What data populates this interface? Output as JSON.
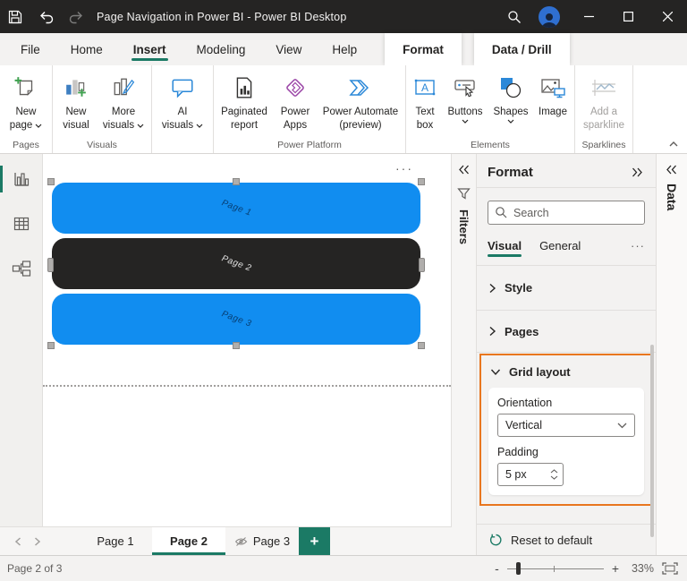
{
  "colors": {
    "accent_green": "#1B7A65",
    "button_blue": "#118DF0",
    "button_black": "#252423",
    "highlight_orange": "#E8761E",
    "titlebar_bg": "#252423"
  },
  "titlebar": {
    "title": "Page Navigation in Power BI - Power BI Desktop"
  },
  "menu": {
    "tabs": [
      {
        "label": "File"
      },
      {
        "label": "Home"
      },
      {
        "label": "Insert"
      },
      {
        "label": "Modeling"
      },
      {
        "label": "View"
      },
      {
        "label": "Help"
      }
    ],
    "active_tab": "Insert",
    "contextual_tabs": [
      {
        "label": "Format"
      },
      {
        "label": "Data / Drill"
      }
    ]
  },
  "ribbon": {
    "groups": [
      {
        "label": "Pages",
        "items": [
          {
            "line1": "New",
            "line2": "page"
          }
        ]
      },
      {
        "label": "Visuals",
        "items": [
          {
            "line1": "New",
            "line2": "visual"
          },
          {
            "line1": "More",
            "line2": "visuals"
          }
        ]
      },
      {
        "label": "",
        "items": [
          {
            "line1": "AI",
            "line2": "visuals"
          }
        ]
      },
      {
        "label": "Power Platform",
        "items": [
          {
            "line1": "Paginated",
            "line2": "report"
          },
          {
            "line1": "Power",
            "line2": "Apps"
          },
          {
            "line1": "Power Automate",
            "line2": "(preview)"
          }
        ]
      },
      {
        "label": "Elements",
        "items": [
          {
            "line1": "Text",
            "line2": "box",
            "icon_letter": "A"
          },
          {
            "line1": "Buttons"
          },
          {
            "line1": "Shapes"
          },
          {
            "line1": "Image"
          }
        ]
      },
      {
        "label": "Sparklines",
        "items": [
          {
            "line1": "Add a",
            "line2": "sparkline",
            "disabled": true
          }
        ]
      }
    ]
  },
  "canvas": {
    "more_options": "···",
    "buttons": [
      {
        "label": "Page 1"
      },
      {
        "label": "Page 2"
      },
      {
        "label": "Page 3"
      }
    ]
  },
  "filters_panel": {
    "title": "Filters"
  },
  "format_panel": {
    "title": "Format",
    "search_placeholder": "Search",
    "tabs": [
      {
        "label": "Visual"
      },
      {
        "label": "General"
      }
    ],
    "more": "···",
    "sections": {
      "style": "Style",
      "pages": "Pages",
      "grid_layout": "Grid layout"
    },
    "grid_layout": {
      "orientation_label": "Orientation",
      "orientation_value": "Vertical",
      "padding_label": "Padding",
      "padding_value": "5 px"
    },
    "reset_label": "Reset to default"
  },
  "data_panel": {
    "title": "Data"
  },
  "page_tabs": {
    "items": [
      {
        "label": "Page 1"
      },
      {
        "label": "Page 2"
      },
      {
        "label": "Page 3"
      }
    ],
    "active": "Page 2",
    "add_label": "+"
  },
  "status_bar": {
    "page_indicator": "Page 2 of 3",
    "zoom_out": "-",
    "zoom_in": "+",
    "zoom_level": "33%"
  }
}
